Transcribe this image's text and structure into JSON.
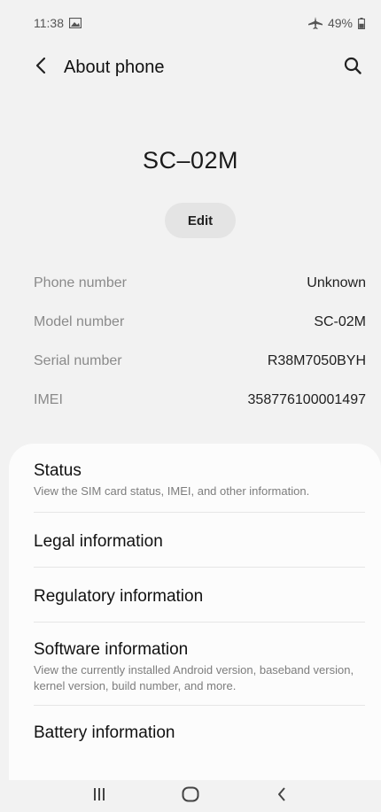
{
  "status_bar": {
    "time": "11:38",
    "battery": "49%",
    "icons": [
      "gallery-notification-icon",
      "airplane-mode-icon",
      "battery-icon"
    ]
  },
  "app_bar": {
    "title": "About phone",
    "back_icon": "back-arrow-icon",
    "search_icon": "search-icon"
  },
  "device": {
    "name": "SC–02M",
    "edit_label": "Edit"
  },
  "info": [
    {
      "label": "Phone number",
      "value": "Unknown"
    },
    {
      "label": "Model number",
      "value": "SC-02M"
    },
    {
      "label": "Serial number",
      "value": "R38M7050BYH"
    },
    {
      "label": "IMEI",
      "value": "358776100001497"
    }
  ],
  "menu": [
    {
      "title": "Status",
      "subtitle": "View the SIM card status, IMEI, and other information."
    },
    {
      "title": "Legal information"
    },
    {
      "title": "Regulatory information"
    },
    {
      "title": "Software information",
      "subtitle": "View the currently installed Android version, baseband version, kernel version, build number, and more."
    },
    {
      "title": "Battery information"
    }
  ],
  "nav_bar": {
    "icons": [
      "recent-apps-icon",
      "home-icon",
      "back-icon"
    ]
  },
  "colors": {
    "background": "#f2f2f2",
    "card": "#fcfcfc",
    "label_gray": "#8a8a8a",
    "edit_button": "#e4e4e4"
  }
}
